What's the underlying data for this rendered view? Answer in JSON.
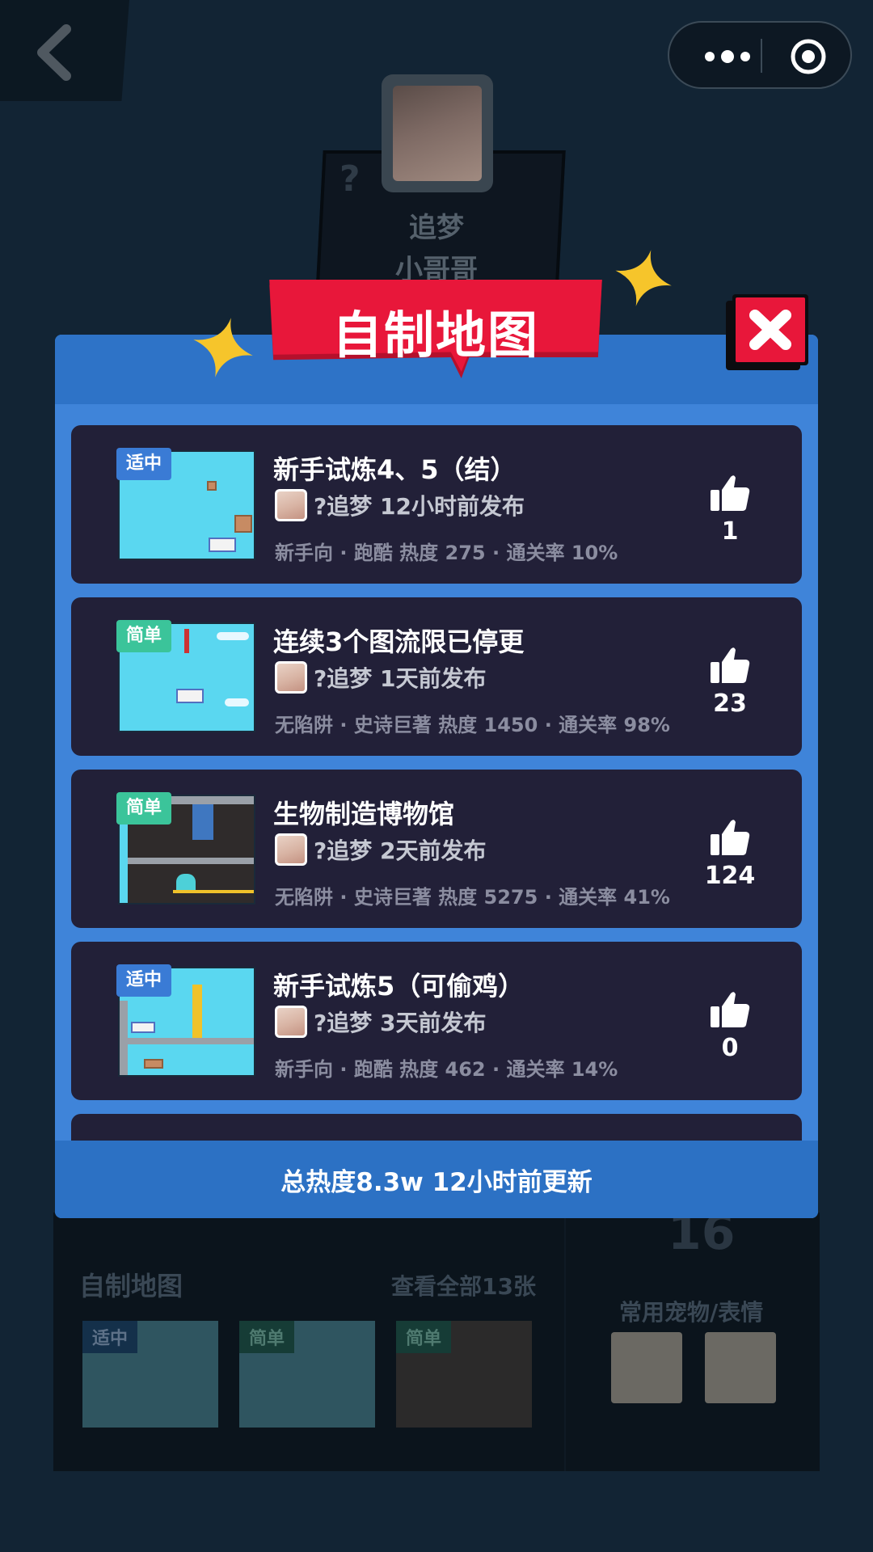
{
  "colors": {
    "modal_bg": "#3f84d9",
    "modal_head": "#2e73c7",
    "card_bg": "#222038",
    "banner_red": "#e8173a",
    "tag_mid": "#3a7bd5",
    "tag_easy": "#3bc49a",
    "sparkle": "#f6c52b"
  },
  "background": {
    "profile_name_line1": "追梦",
    "profile_name_line2": "小哥哥",
    "question_mark": "?",
    "section_title": "自制地图",
    "view_all": "查看全部13张",
    "big_number": "16",
    "pets_title": "常用宠物/表情",
    "thumbs": [
      {
        "tag": "适中"
      },
      {
        "tag": "简单"
      },
      {
        "tag": "简单"
      }
    ]
  },
  "capsule": {
    "more_icon": "more-dots-icon",
    "close_icon": "target-circle-icon"
  },
  "modal": {
    "title": "自制地图",
    "close_icon": "close-x-icon",
    "footer": "总热度8.3w 12小时前更新",
    "maps": [
      {
        "difficulty": "适中",
        "difficulty_type": "mid",
        "title": "新手试炼4、5（结）",
        "author": "?追梦 12小时前发布",
        "meta": "新手向 · 跑酷 热度 275 · 通关率 10%",
        "likes": "1"
      },
      {
        "difficulty": "简单",
        "difficulty_type": "easy",
        "title": "连续3个图流限已停更",
        "author": "?追梦 1天前发布",
        "meta": "无陷阱 · 史诗巨著 热度 1450 · 通关率 98%",
        "likes": "23"
      },
      {
        "difficulty": "简单",
        "difficulty_type": "easy",
        "title": "生物制造博物馆",
        "author": "?追梦 2天前发布",
        "meta": "无陷阱 · 史诗巨著 热度 5275 · 通关率 41%",
        "likes": "124"
      },
      {
        "difficulty": "适中",
        "difficulty_type": "mid",
        "title": "新手试炼5（可偷鸡）",
        "author": "?追梦 3天前发布",
        "meta": "新手向 · 跑酷 热度 462 · 通关率 14%",
        "likes": "0"
      }
    ]
  }
}
